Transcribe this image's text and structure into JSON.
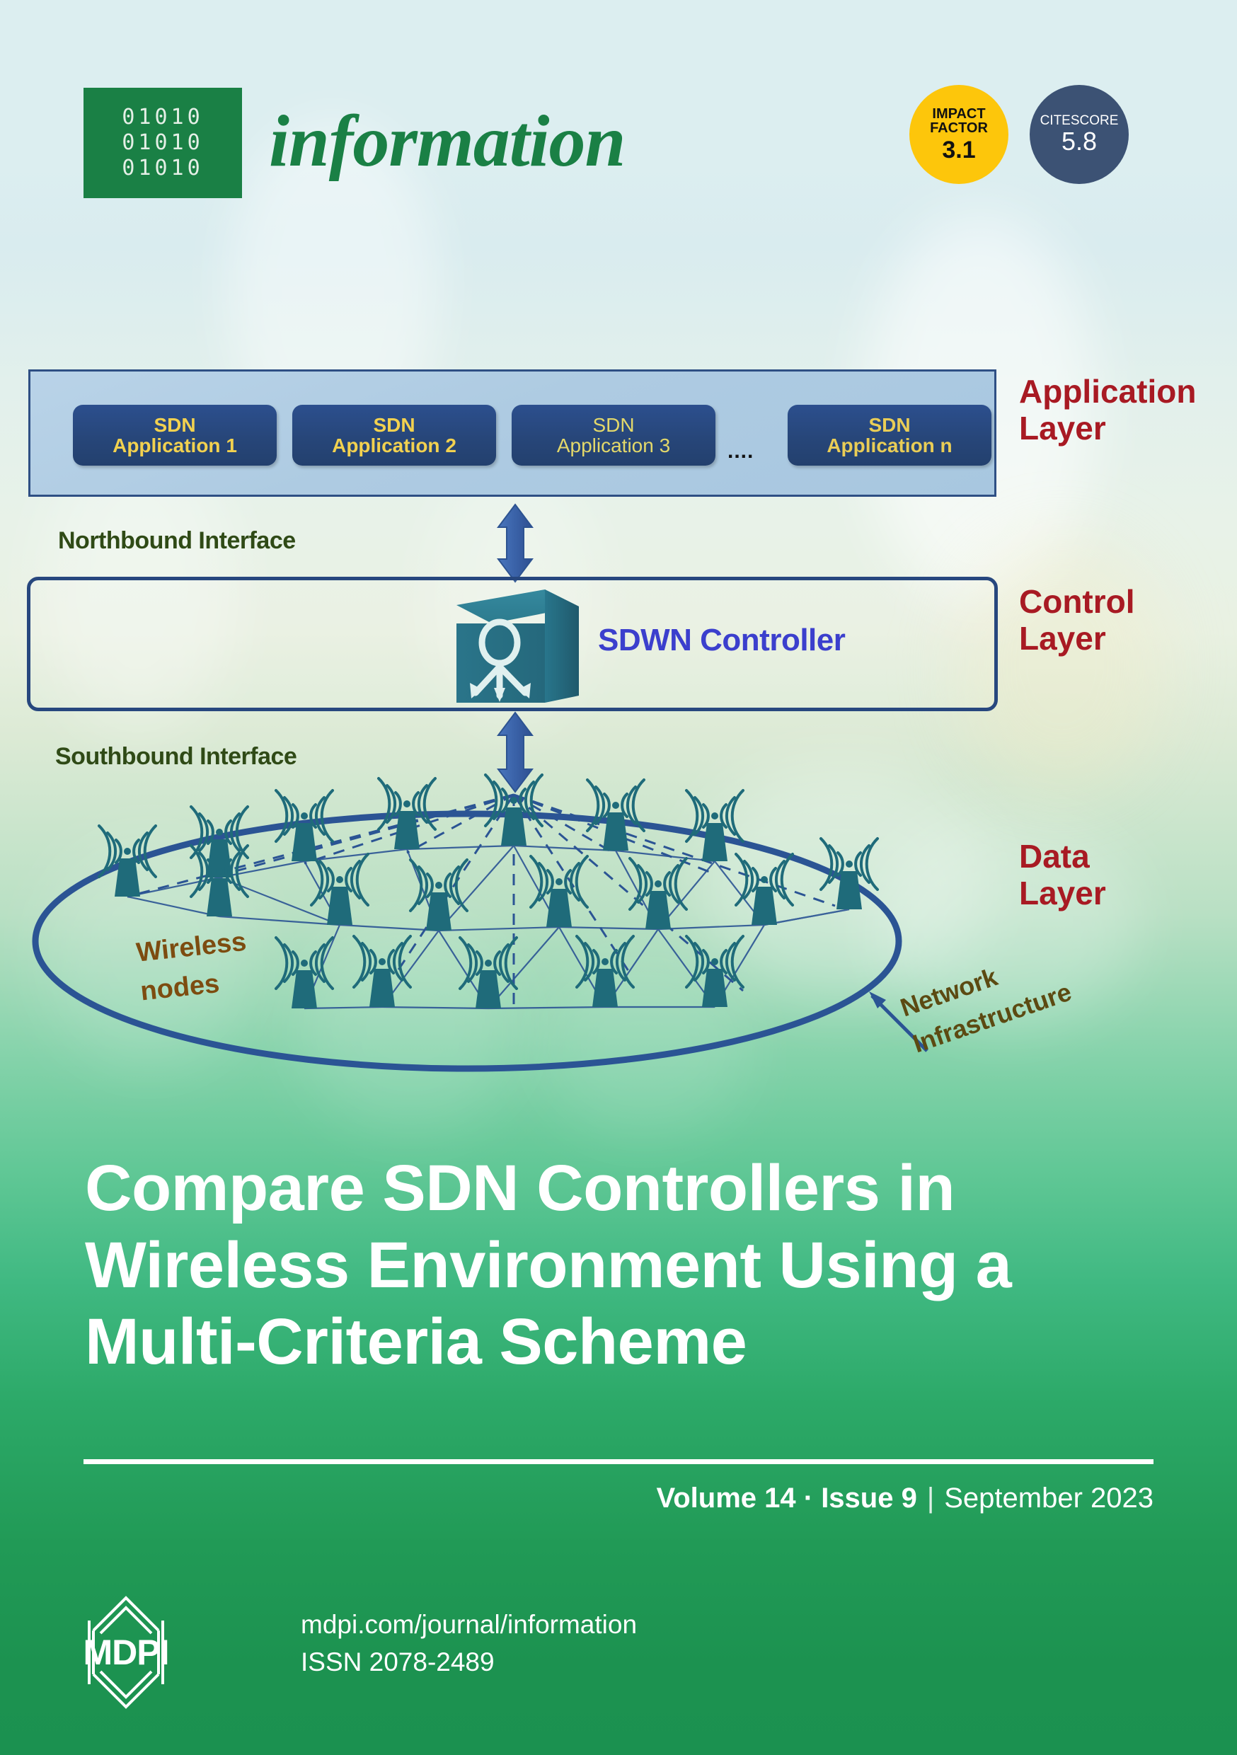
{
  "masthead": {
    "binary_rows": [
      "01010",
      "01010",
      "01010"
    ],
    "journal_name": "information",
    "impact_factor": {
      "label_line1": "IMPACT",
      "label_line2": "FACTOR",
      "value": "3.1",
      "color": "#fdc60b"
    },
    "citescore": {
      "label": "CITESCORE",
      "value": "5.8",
      "color": "#3c5274"
    }
  },
  "diagram": {
    "application_layer": {
      "label_line1": "Application",
      "label_line2": "Layer",
      "apps": [
        {
          "line1": "SDN",
          "line2": "Application 1"
        },
        {
          "line1": "SDN",
          "line2": "Application 2"
        },
        {
          "line1": "SDN",
          "line2": "Application 3"
        },
        {
          "line1": "SDN",
          "line2": "Application n"
        }
      ],
      "ellipsis": "...."
    },
    "northbound_interface": "Northbound Interface",
    "control_layer": {
      "label_line1": "Control",
      "label_line2": "Layer",
      "controller": "SDWN Controller"
    },
    "southbound_interface": "Southbound Interface",
    "data_layer": {
      "label_line1": "Data",
      "label_line2": "Layer",
      "wireless_nodes_line1": "Wireless",
      "wireless_nodes_line2": "nodes",
      "network_infra_line1": "Network",
      "network_infra_line2": "Infrastructure"
    },
    "colors": {
      "layer_label_red": "#a81a23",
      "interface_green": "#2f4a16",
      "app_box_blue": "#274679",
      "app_box_text_yellow": "#f2d14f",
      "controller_blue": "#3b3fcd",
      "node_teal": "#1f6b7a",
      "ellipse_blue": "#2b5494",
      "wireless_label_brown": "#7d4c10",
      "infra_label_brown": "#5c4a12"
    }
  },
  "headline": "Compare SDN Controllers in Wireless Environment Using a Multi-Criteria Scheme",
  "issue": {
    "volume": "Volume 14 · Issue 9",
    "separator": "|",
    "date": "September 2023"
  },
  "footer": {
    "publisher": "MDPI",
    "url": "mdpi.com/journal/information",
    "issn": "ISSN 2078-2489"
  }
}
